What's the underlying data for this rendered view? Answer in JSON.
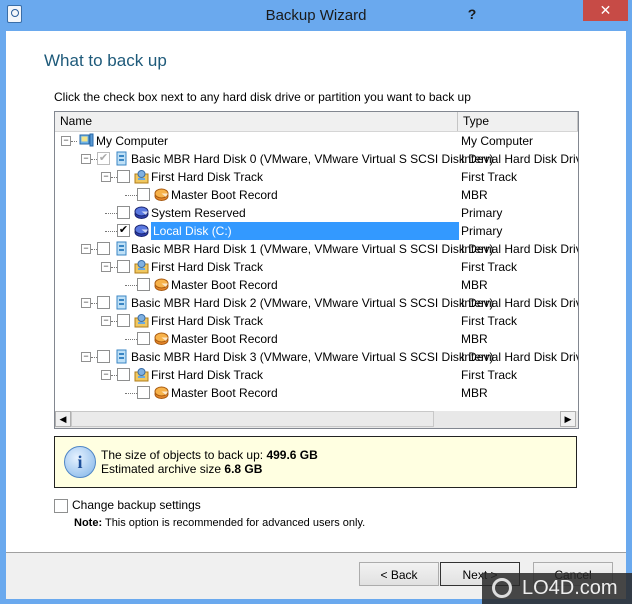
{
  "window": {
    "title": "Backup Wizard",
    "help_label": "?",
    "close_label": "✕"
  },
  "page": {
    "heading": "What to back up",
    "instruction": "Click the check box next to any hard disk drive or partition you want to back up"
  },
  "tree": {
    "columns": [
      {
        "label": "Name"
      },
      {
        "label": "Type"
      }
    ],
    "rows": [
      {
        "name": "My Computer",
        "type": "My Computer",
        "level": 0,
        "icon": "computer-icon",
        "checkbox": "none",
        "expander": "minus"
      },
      {
        "name": "Basic MBR Hard Disk 0 (VMware, VMware Virtual S SCSI Disk Dev)",
        "type": "Internal Hard Disk Drive",
        "level": 1,
        "icon": "hard-disk-icon",
        "checkbox": "partial",
        "expander": "minus"
      },
      {
        "name": "First Hard Disk Track",
        "type": "First Track",
        "level": 2,
        "icon": "disk-track-icon",
        "checkbox": "unchecked",
        "expander": "minus"
      },
      {
        "name": "Master Boot Record",
        "type": "MBR",
        "level": 3,
        "icon": "mbr-icon",
        "checkbox": "unchecked",
        "expander": "none"
      },
      {
        "name": "System Reserved",
        "type": "Primary",
        "level": 2,
        "icon": "partition-icon",
        "checkbox": "unchecked",
        "expander": "none"
      },
      {
        "name": "Local Disk (C:)",
        "type": "Primary",
        "level": 2,
        "icon": "partition-icon",
        "checkbox": "checked",
        "expander": "none",
        "selected": true
      },
      {
        "name": "Basic MBR Hard Disk 1 (VMware, VMware Virtual S SCSI Disk Dev)",
        "type": "Internal Hard Disk Drive",
        "level": 1,
        "icon": "hard-disk-icon",
        "checkbox": "unchecked",
        "expander": "minus"
      },
      {
        "name": "First Hard Disk Track",
        "type": "First Track",
        "level": 2,
        "icon": "disk-track-icon",
        "checkbox": "unchecked",
        "expander": "minus"
      },
      {
        "name": "Master Boot Record",
        "type": "MBR",
        "level": 3,
        "icon": "mbr-icon",
        "checkbox": "unchecked",
        "expander": "none"
      },
      {
        "name": "Basic MBR Hard Disk 2 (VMware, VMware Virtual S SCSI Disk Dev)",
        "type": "Internal Hard Disk Drive",
        "level": 1,
        "icon": "hard-disk-icon",
        "checkbox": "unchecked",
        "expander": "minus"
      },
      {
        "name": "First Hard Disk Track",
        "type": "First Track",
        "level": 2,
        "icon": "disk-track-icon",
        "checkbox": "unchecked",
        "expander": "minus"
      },
      {
        "name": "Master Boot Record",
        "type": "MBR",
        "level": 3,
        "icon": "mbr-icon",
        "checkbox": "unchecked",
        "expander": "none"
      },
      {
        "name": "Basic MBR Hard Disk 3 (VMware, VMware Virtual S SCSI Disk Dev)",
        "type": "Internal Hard Disk Drive",
        "level": 1,
        "icon": "hard-disk-icon",
        "checkbox": "unchecked",
        "expander": "minus"
      },
      {
        "name": "First Hard Disk Track",
        "type": "First Track",
        "level": 2,
        "icon": "disk-track-icon",
        "checkbox": "unchecked",
        "expander": "minus"
      },
      {
        "name": "Master Boot Record",
        "type": "MBR",
        "level": 3,
        "icon": "mbr-icon",
        "checkbox": "unchecked",
        "expander": "none"
      }
    ]
  },
  "info": {
    "size_label": "The size of objects to back up:",
    "size_value": "499.6 GB",
    "archive_label": "Estimated archive size",
    "archive_value": "6.8 GB"
  },
  "options": {
    "change_settings_label": "Change backup settings",
    "change_settings_checked": false,
    "note_label": "Note:",
    "note_text": "This option is recommended for advanced users only."
  },
  "buttons": {
    "back": "< Back",
    "next": "Next >",
    "cancel": "Cancel"
  },
  "watermark": "LO4D.com",
  "colors": {
    "titlebar": "#6aa9ee",
    "close": "#c74b46",
    "selection": "#3399ff",
    "heading": "#1e5a7a",
    "info_bg": "#ffffe1"
  }
}
